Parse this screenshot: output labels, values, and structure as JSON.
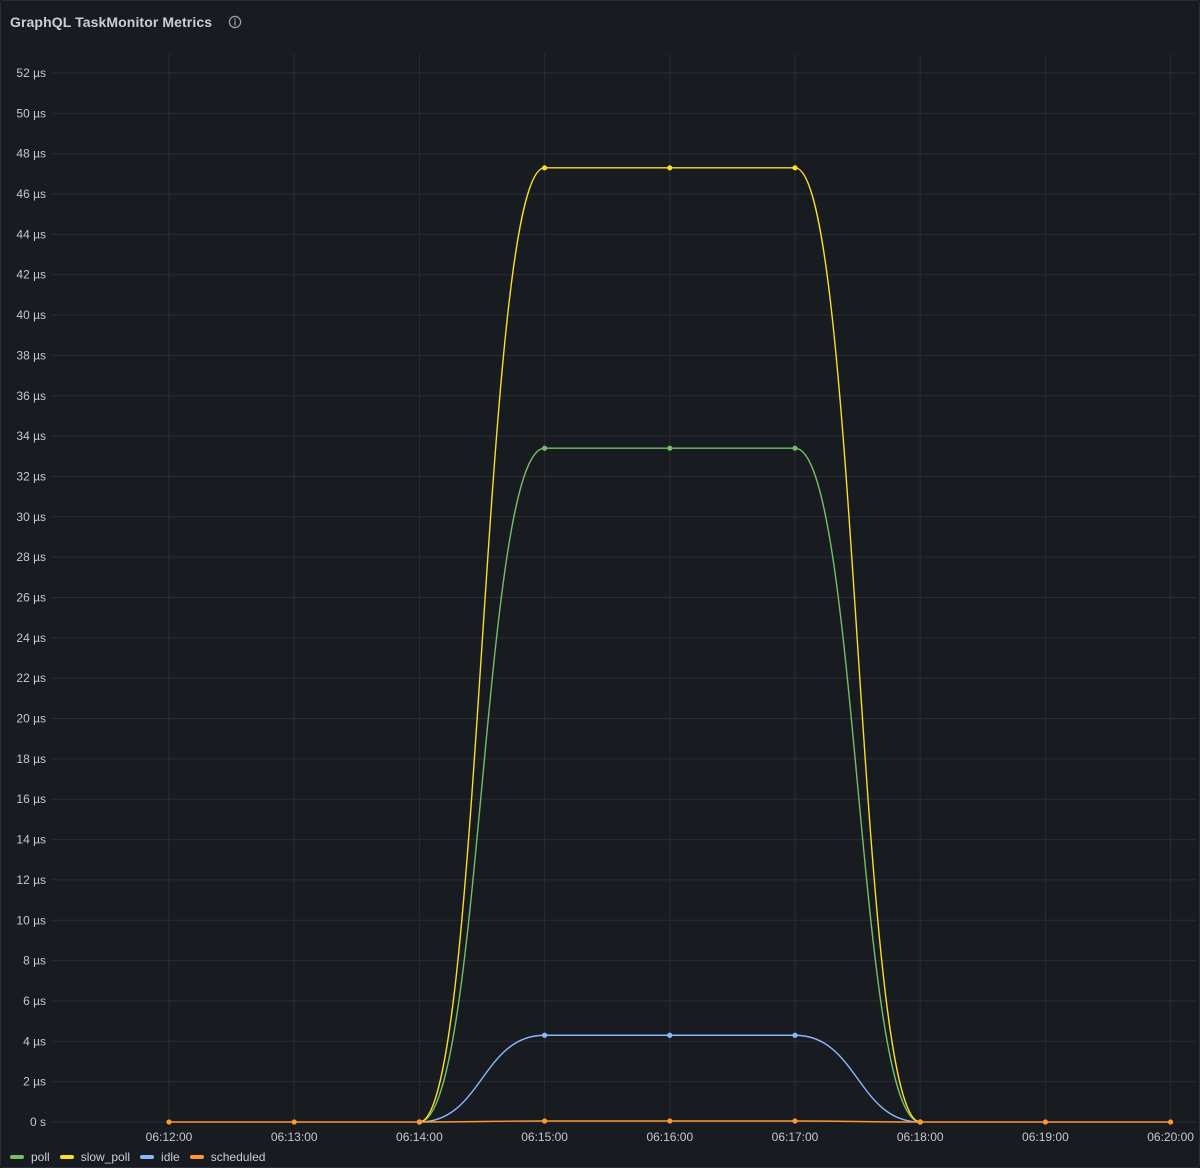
{
  "panel": {
    "title": "GraphQL TaskMonitor Metrics",
    "info_icon": "info-circle-icon"
  },
  "colors": {
    "background": "#181b1f",
    "grid": "#2a2d33",
    "axis_text": "#c7c7d1"
  },
  "chart_data": {
    "type": "line",
    "title": "GraphQL TaskMonitor Metrics",
    "xlabel": "",
    "ylabel": "",
    "x": [
      "06:14:00",
      "06:15:00",
      "06:16:00",
      "06:17:00",
      "06:18:00"
    ],
    "x_ticks": [
      "06:12:00",
      "06:13:00",
      "06:14:00",
      "06:15:00",
      "06:16:00",
      "06:17:00",
      "06:18:00",
      "06:19:00",
      "06:20:00"
    ],
    "y_ticks": [
      "0 s",
      "2 µs",
      "4 µs",
      "6 µs",
      "8 µs",
      "10 µs",
      "12 µs",
      "14 µs",
      "16 µs",
      "18 µs",
      "20 µs",
      "22 µs",
      "24 µs",
      "26 µs",
      "28 µs",
      "30 µs",
      "32 µs",
      "34 µs",
      "36 µs",
      "38 µs",
      "40 µs",
      "42 µs",
      "44 µs",
      "46 µs",
      "48 µs",
      "50 µs",
      "52 µs"
    ],
    "ylim": [
      0,
      52
    ],
    "y_unit": "µs",
    "grid": true,
    "legend_position": "bottom-left",
    "series": [
      {
        "name": "poll",
        "color": "#73bf69",
        "values": [
          0,
          33.4,
          33.4,
          33.4,
          0
        ]
      },
      {
        "name": "slow_poll",
        "color": "#fade2a",
        "values": [
          0,
          47.3,
          47.3,
          47.3,
          0
        ]
      },
      {
        "name": "idle",
        "color": "#8ab8ff",
        "values": [
          0,
          4.3,
          4.3,
          4.3,
          0
        ]
      },
      {
        "name": "scheduled",
        "color": "#ff9830",
        "x": [
          "06:12:00",
          "06:13:00",
          "06:14:00",
          "06:15:00",
          "06:16:00",
          "06:17:00",
          "06:18:00",
          "06:19:00",
          "06:20:00"
        ],
        "values": [
          0,
          0,
          0,
          0.05,
          0.05,
          0.05,
          0,
          0,
          0
        ]
      }
    ]
  }
}
